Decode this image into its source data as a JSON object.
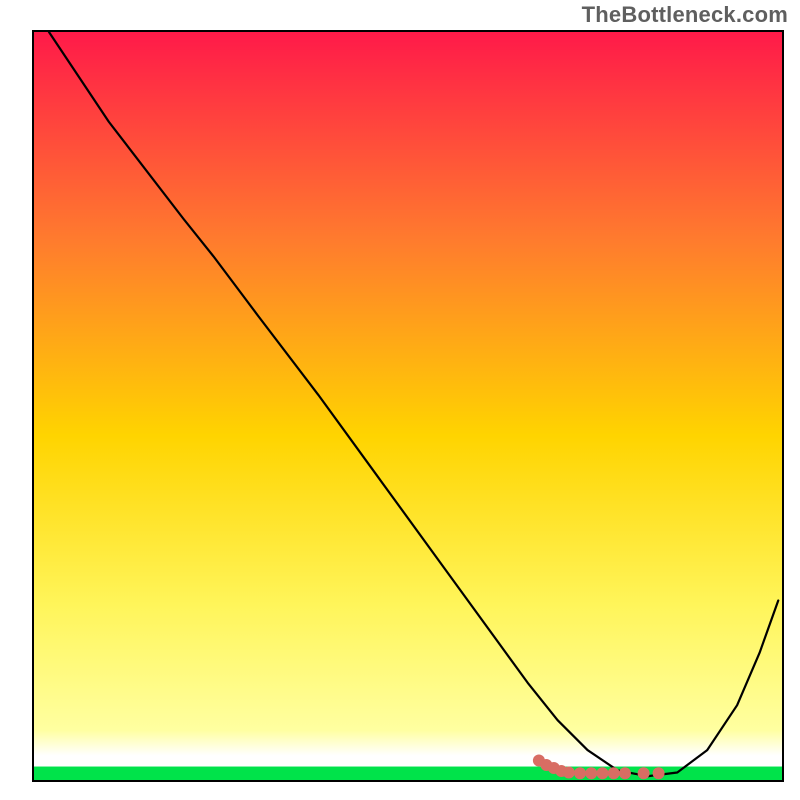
{
  "watermark": "TheBottleneck.com",
  "chart_data": {
    "type": "line",
    "title": "",
    "xlabel": "",
    "ylabel": "",
    "xlim": [
      0,
      100
    ],
    "ylim": [
      0,
      100
    ],
    "background_gradient": {
      "top": "#ff1a49",
      "mid_upper": "#ff7a2e",
      "mid": "#ffd400",
      "mid_lower": "#fff55a",
      "near_bottom": "#ffffa0",
      "bottom_band": "#00e34a"
    },
    "green_band_fraction": 0.018,
    "series": [
      {
        "name": "bottleneck-curve",
        "color": "#000000",
        "width": 2.2,
        "x": [
          2,
          10,
          20,
          24,
          30,
          38,
          46,
          54,
          62,
          66,
          70,
          74,
          78,
          82,
          86,
          90,
          94,
          97,
          99.5
        ],
        "y": [
          100,
          88,
          75,
          70,
          62,
          51.5,
          40.5,
          29.5,
          18.5,
          13,
          8,
          4,
          1.3,
          0.5,
          1.0,
          4,
          10,
          17,
          24
        ]
      }
    ],
    "markers": {
      "name": "highlight-cluster",
      "color": "#d86d63",
      "radius": 6,
      "points_x": [
        67.5,
        68.5,
        69.5,
        70.5,
        71.5,
        73.0,
        74.5,
        76.0,
        77.5,
        79.0,
        81.5,
        83.5
      ],
      "points_y": [
        2.6,
        2.0,
        1.6,
        1.2,
        1.0,
        0.9,
        0.9,
        0.9,
        0.9,
        0.9,
        0.9,
        0.9
      ]
    }
  }
}
